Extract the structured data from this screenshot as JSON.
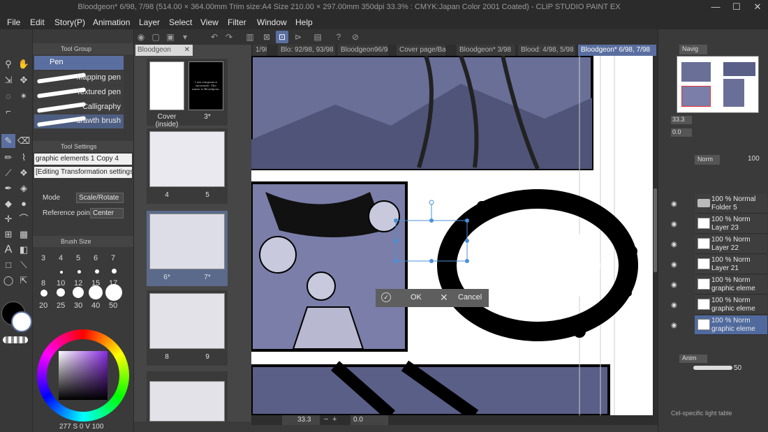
{
  "window": {
    "title": "Bloodgeon* 6/98, 7/98 (514.00 × 364.00mm Trim size:A4 Size 210.00 × 297.00mm 350dpi 33.3% : CMYK:Japan Color 2001 Coated) - CLIP STUDIO PAINT EX",
    "minimize": "—",
    "maximize": "☐",
    "close": "✕"
  },
  "menu": [
    "File",
    "Edit",
    "Story(P)",
    "Animation",
    "Layer",
    "Select",
    "View",
    "Filter",
    "Window",
    "Help"
  ],
  "subtool": {
    "header": "Tool Group",
    "active_tool": "Pen",
    "brushes": [
      "Mapping pen",
      "Textured pen",
      "Calligraphy",
      "drawth brush"
    ],
    "tool_settings_header": "Tool Settings",
    "layer_name": "graphic elements 1 Copy 4",
    "editing_label": "[Editing Transformation settings]",
    "mode_label": "Mode",
    "mode_value": "Scale/Rotate",
    "ref_label": "Reference point",
    "ref_value": "Center",
    "brush_size_header": "Brush Size",
    "sizes": [
      "3",
      "4",
      "5",
      "6",
      "7",
      "8",
      "10",
      "12",
      "15",
      "17",
      "20",
      "25",
      "30",
      "40",
      "50"
    ],
    "color_status": "277 S  0  V 100"
  },
  "pages": {
    "tab": "Bloodgeon",
    "thumbs": [
      {
        "left": "Cover (inside)",
        "right": "3*"
      },
      {
        "left": "4",
        "right": "5"
      },
      {
        "left": "6*",
        "right": "7*"
      },
      {
        "left": "8",
        "right": "9"
      }
    ],
    "dark_page_text": "I am vengeance incarnate. The name is Bloodgeon."
  },
  "doc_tabs": [
    "1/98",
    "Blo: 92/98, 93/98",
    "Bloodgeon96/98",
    "Cover page/Bac",
    "Bloodgeon* 3/98",
    "Blood: 4/98, 5/98",
    "Bloodgeon* 6/98, 7/98"
  ],
  "canvas": {
    "ok_label": "OK",
    "cancel_label": "Cancel",
    "zoom": "33.3",
    "angle": "0.0"
  },
  "right": {
    "navigator_tab": "Navig",
    "zoom": "33.3",
    "angle": "0.0",
    "blend_mode": "Norm",
    "opacity": "100",
    "layers": [
      {
        "t1": "100 % Normal",
        "t2": "Folder 5",
        "folder": true,
        "sel": false
      },
      {
        "t1": "100 % Norm",
        "t2": "Layer 23",
        "folder": false,
        "sel": false
      },
      {
        "t1": "100 % Norm",
        "t2": "Layer 22",
        "folder": false,
        "sel": false
      },
      {
        "t1": "100 % Norm",
        "t2": "Layer 21",
        "folder": false,
        "sel": false
      },
      {
        "t1": "100 % Norm",
        "t2": "graphic eleme",
        "folder": false,
        "sel": false
      },
      {
        "t1": "100 % Norm",
        "t2": "graphic eleme",
        "folder": false,
        "sel": false
      },
      {
        "t1": "100 % Norm",
        "t2": "graphic eleme",
        "folder": false,
        "sel": true
      }
    ],
    "anim_tab": "Anim",
    "anim_value": "50",
    "status": "Cel-specific light table"
  },
  "colors": {
    "accent": "#5a6fa0",
    "selected_layer": "#506a9e",
    "ink_blue": "#6a6f98"
  }
}
